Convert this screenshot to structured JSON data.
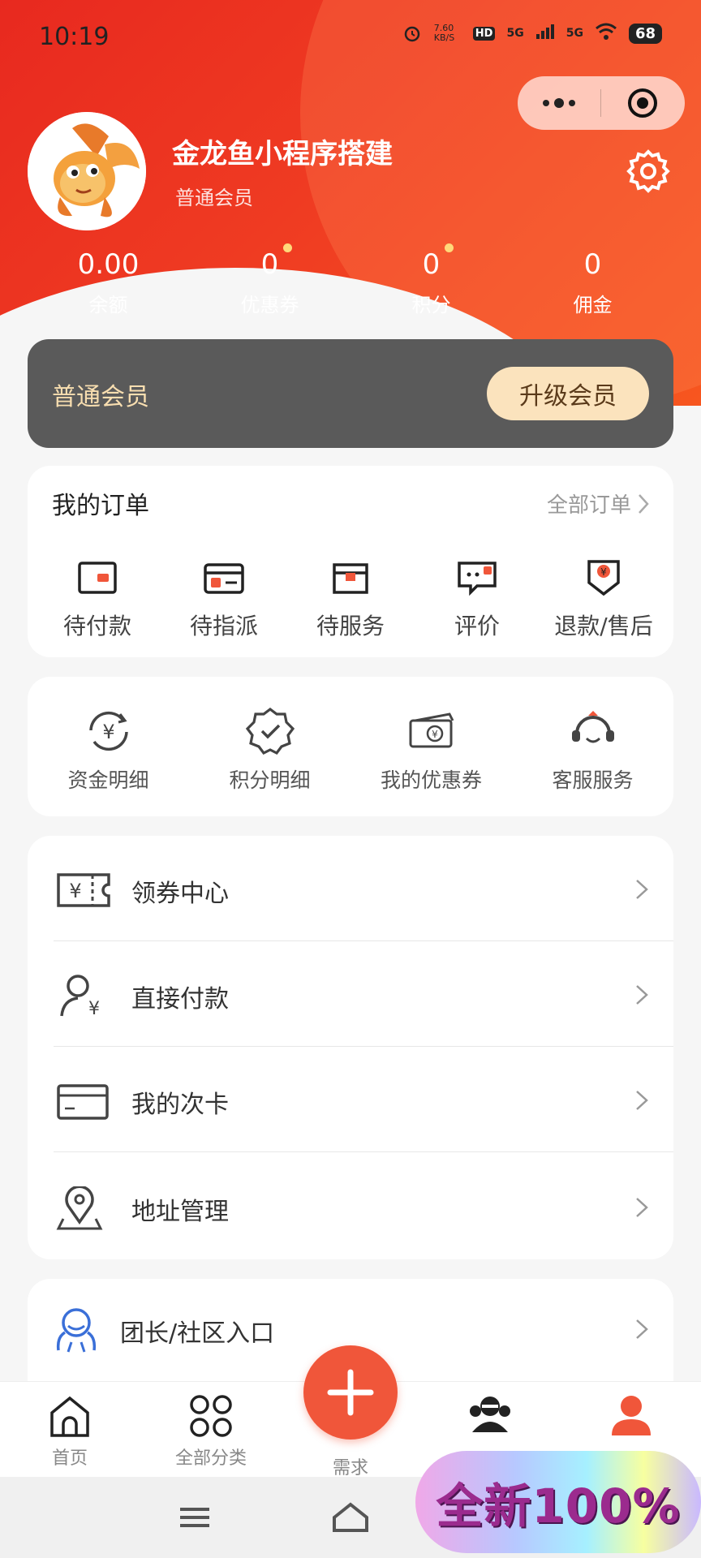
{
  "status_bar": {
    "time": "10:19",
    "net_speed": "7.60 KB/S",
    "hd": "HD",
    "signal1": "5G",
    "signal2": "5G",
    "battery": "68"
  },
  "profile": {
    "name": "金龙鱼小程序搭建",
    "level": "普通会员",
    "avatar_icon": "goldfish-avatar"
  },
  "stats": [
    {
      "value": "0.00",
      "label": "余额",
      "dot": false
    },
    {
      "value": "0",
      "label": "优惠券",
      "dot": true
    },
    {
      "value": "0",
      "label": "积分",
      "dot": true
    },
    {
      "value": "0",
      "label": "佣金",
      "dot": false
    }
  ],
  "member_bar": {
    "label": "普通会员",
    "button": "升级会员"
  },
  "orders": {
    "title": "我的订单",
    "all_label": "全部订单",
    "items": [
      {
        "label": "待付款",
        "icon": "wallet-icon"
      },
      {
        "label": "待指派",
        "icon": "card-icon"
      },
      {
        "label": "待服务",
        "icon": "box-icon"
      },
      {
        "label": "评价",
        "icon": "comment-icon"
      },
      {
        "label": "退款/售后",
        "icon": "refund-icon"
      }
    ]
  },
  "tools": [
    {
      "label": "资金明细",
      "icon": "yen-cycle-icon"
    },
    {
      "label": "积分明细",
      "icon": "badge-check-icon"
    },
    {
      "label": "我的优惠券",
      "icon": "coupon-ticket-icon"
    },
    {
      "label": "客服服务",
      "icon": "headset-icon"
    }
  ],
  "menu": [
    {
      "label": "领券中心",
      "icon": "voucher-icon"
    },
    {
      "label": "直接付款",
      "icon": "user-pay-icon"
    },
    {
      "label": "我的次卡",
      "icon": "card-icon"
    },
    {
      "label": "地址管理",
      "icon": "location-icon"
    }
  ],
  "group_entry": {
    "label": "团长/社区入口",
    "icon": "community-icon"
  },
  "tabbar": [
    {
      "label": "首页",
      "icon": "home-icon"
    },
    {
      "label": "全部分类",
      "icon": "grid-icon"
    },
    {
      "label": "需求",
      "icon": "plus-icon"
    },
    {
      "label": "",
      "icon": "group-icon"
    },
    {
      "label": "",
      "icon": "user-icon"
    }
  ],
  "promo": {
    "text": "全新100%"
  },
  "colors": {
    "brand_red": "#ef3b22",
    "accent_orange": "#f0563a",
    "member_gold": "#fbe3bd"
  }
}
